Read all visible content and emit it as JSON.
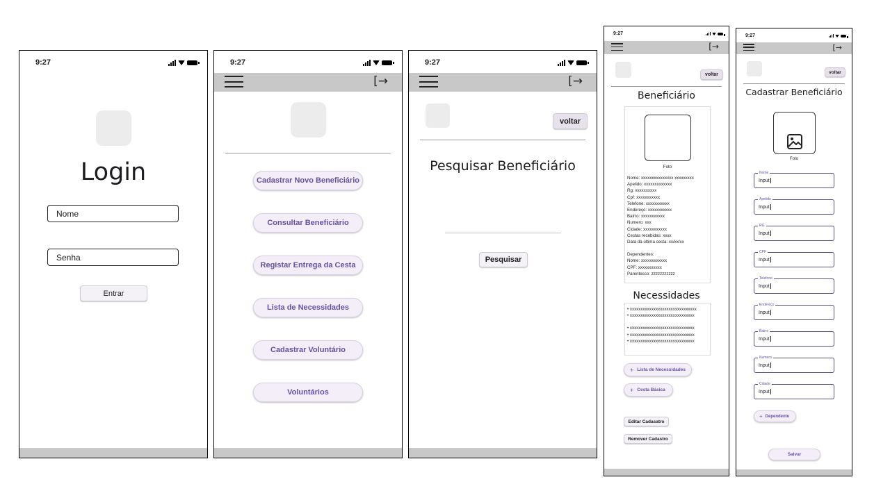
{
  "status_time": "9:27",
  "login": {
    "title": "Login",
    "name_field": "Nome",
    "password_field": "Senha",
    "submit_label": "Entrar"
  },
  "menu": {
    "items": [
      "Cadastrar Novo Beneficiário",
      "Consultar Beneficiário",
      "Registar Entrega da Cesta",
      "Lista de Necessidades",
      "Cadastrar Voluntário",
      "Voluntários"
    ]
  },
  "search": {
    "back_label": "voltar",
    "title": "Pesquisar Beneficiário",
    "search_button": "Pesquisar"
  },
  "detail": {
    "back_label": "voltar",
    "title": "Beneficiário",
    "photo_label": "Foto",
    "info_lines": [
      "Nome: xxxxxxxxxxxxxxx xxxxxxxxx",
      "Apelido: xxxxxxxxxxxxx",
      "Rg: xxxxxxxxxx",
      "Cpf: xxxxxxxxxxx",
      "Telefone: xxxxxxxxxxx",
      "Endereço: xxxxxxxxxxx",
      "Bairro: xxxxxxxxxxx",
      "Numero: xxx",
      "Cidade: xxxxxxxxxxx",
      "Cestas recebidas: xxxx",
      "Data da última cesta: xx/xx/xx"
    ],
    "dependents_lines": [
      "Dependentes:",
      "Nome: xxxxxxxxxxxx",
      "CPF: xxxxxxxxxxx",
      "Parentesco: zzzzzzzzzzz"
    ],
    "needs_title": "Necessidades",
    "needs_lines": [
      "• xxxxxxxxxxxxxxxxxxxxxxxxxxxxxxx",
      "• xxxxxxxxxxxxxxxxxxxxxxxxxxxxxx",
      "• xxxxxxxxxxxxxxxxxxxxxxxxxxxxxx",
      "• xxxxxxxxxxxxxxxxxxxxxxxxxxxxxx",
      "• xxxxxxxxxxxxxxxxxxxxxxxxxxxxxx"
    ],
    "add_needs_label": "Lista de Necessidades",
    "add_basket_label": "Cesta Básica",
    "edit_label": "Editar Cadasatro",
    "remove_label": "Remover Cadastro"
  },
  "register": {
    "back_label": "voltar",
    "title": "Cadastrar Beneficiário",
    "photo_label": "Foto",
    "fields": [
      {
        "label": "Nome",
        "value": "Input"
      },
      {
        "label": "Apelido",
        "value": "Input"
      },
      {
        "label": "RG",
        "value": "Input"
      },
      {
        "label": "CPF",
        "value": "Input"
      },
      {
        "label": "Telefone",
        "value": "Input"
      },
      {
        "label": "Endereço",
        "value": "Input"
      },
      {
        "label": "Bairro",
        "value": "Input"
      },
      {
        "label": "Numero",
        "value": "Input"
      },
      {
        "label": "Cidade",
        "value": "Input"
      }
    ],
    "add_dependent_label": "Dependente",
    "save_label": "Salvar"
  },
  "colors": {
    "accent": "#6750a4",
    "bar": "#c8c8c8",
    "button_bg": "#f3eef8"
  }
}
